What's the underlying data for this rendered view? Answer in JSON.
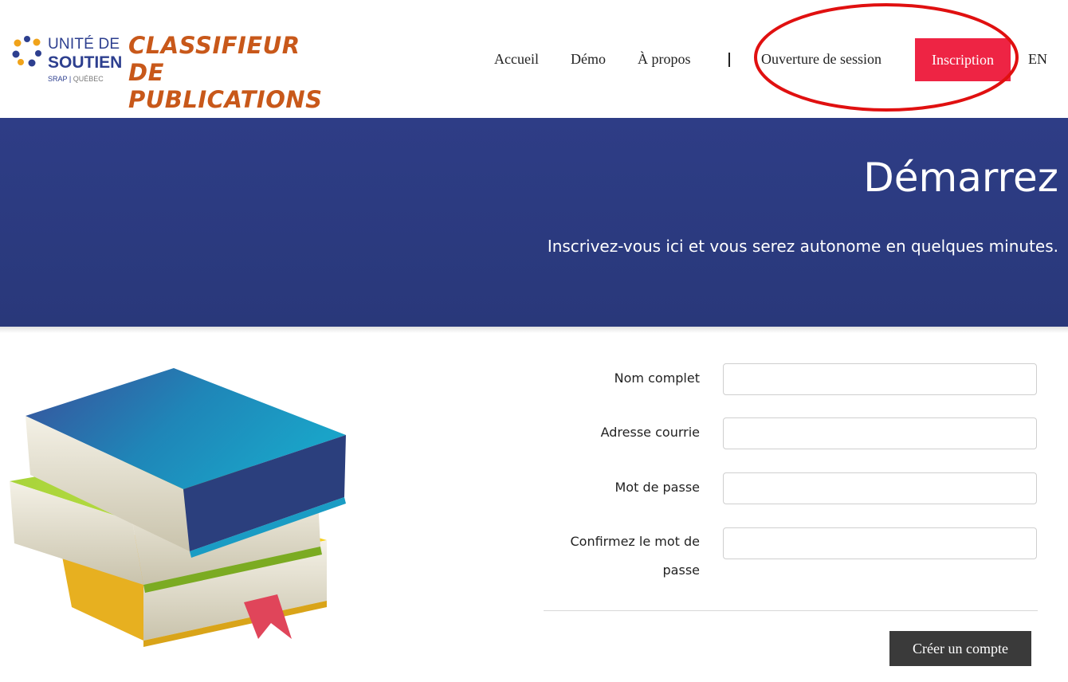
{
  "logo": {
    "line1": "UNITÉ DE",
    "line2": "SOUTIEN",
    "srap": "SRAP",
    "quebec": "QUÉBEC",
    "title_line1": "CLASSIFIEUR DE",
    "title_line2": "PUBLICATIONS"
  },
  "nav": {
    "home": "Accueil",
    "demo": "Démo",
    "about": "À propos",
    "separator": "|",
    "login": "Ouverture de session",
    "signup": "Inscription",
    "language": "EN"
  },
  "hero": {
    "title": "Démarrez",
    "subtitle": "Inscrivez-vous ici et vous serez autonome en quelques minutes."
  },
  "form": {
    "fields": [
      {
        "label": "Nom complet",
        "value": ""
      },
      {
        "label": "Adresse courrie",
        "value": ""
      },
      {
        "label": "Mot de passe",
        "value": ""
      },
      {
        "label": "Confirmez le mot de passe",
        "value": ""
      }
    ],
    "submit_label": "Créer un compte"
  },
  "colors": {
    "brand_blue": "#2e3d86",
    "accent_red": "#ee2444",
    "logo_orange": "#c8581a",
    "submit_dark": "#3a3a3a",
    "annotation_red": "#e01010"
  }
}
